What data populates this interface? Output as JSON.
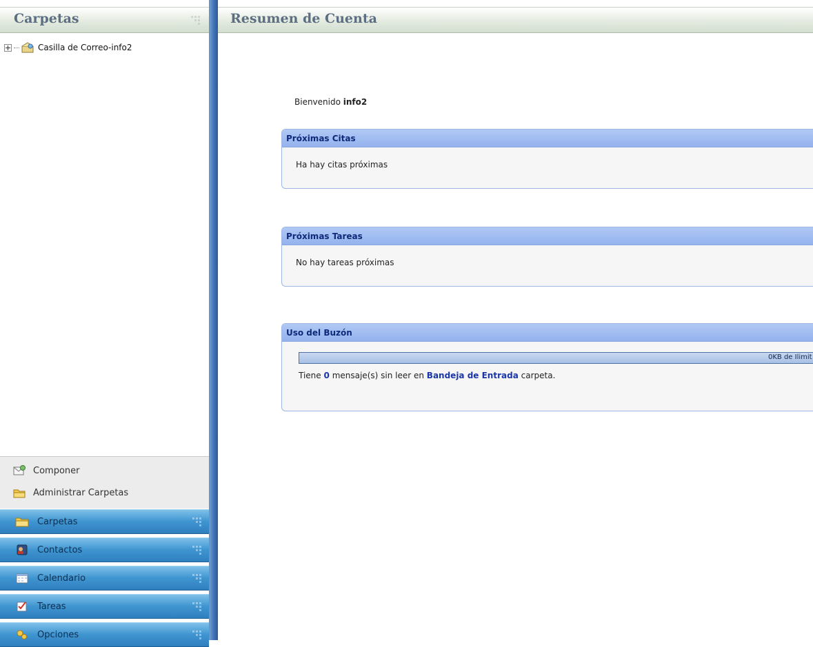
{
  "sidebar": {
    "title": "Carpetas",
    "tree_root_label": "Casilla de Correo-info2",
    "actions": [
      {
        "label": "Componer",
        "icon": "compose-icon"
      },
      {
        "label": "Administrar Carpetas",
        "icon": "manage-folders-icon"
      }
    ],
    "nav": [
      {
        "label": "Carpetas",
        "icon": "folders-icon"
      },
      {
        "label": "Contactos",
        "icon": "contacts-icon"
      },
      {
        "label": "Calendario",
        "icon": "calendar-icon"
      },
      {
        "label": "Tareas",
        "icon": "tasks-icon"
      },
      {
        "label": "Opciones",
        "icon": "options-icon"
      }
    ]
  },
  "main": {
    "title": "Resumen de Cuenta",
    "welcome_prefix": "Bienvenido",
    "username": "info2",
    "appointments": {
      "title": "Próximas Citas",
      "message": "Ha hay citas próximas"
    },
    "tasks": {
      "title": "Próximas Tareas",
      "message": "No hay tareas próximas"
    },
    "mailbox": {
      "title": "Uso del Buzón",
      "usage_text": "0KB de Ilimit",
      "usage_fraction": 0,
      "unread_prefix": "Tiene",
      "unread_count": "0",
      "unread_middle": "mensaje(s) sin leer en",
      "folder_link": "Bandeja de Entrada",
      "unread_suffix": "carpeta."
    }
  },
  "colors": {
    "nav_button": "#3f95d0",
    "splitter": "#3d6fb3",
    "panel_header": "#94b2ee",
    "link": "#1b36a8"
  }
}
